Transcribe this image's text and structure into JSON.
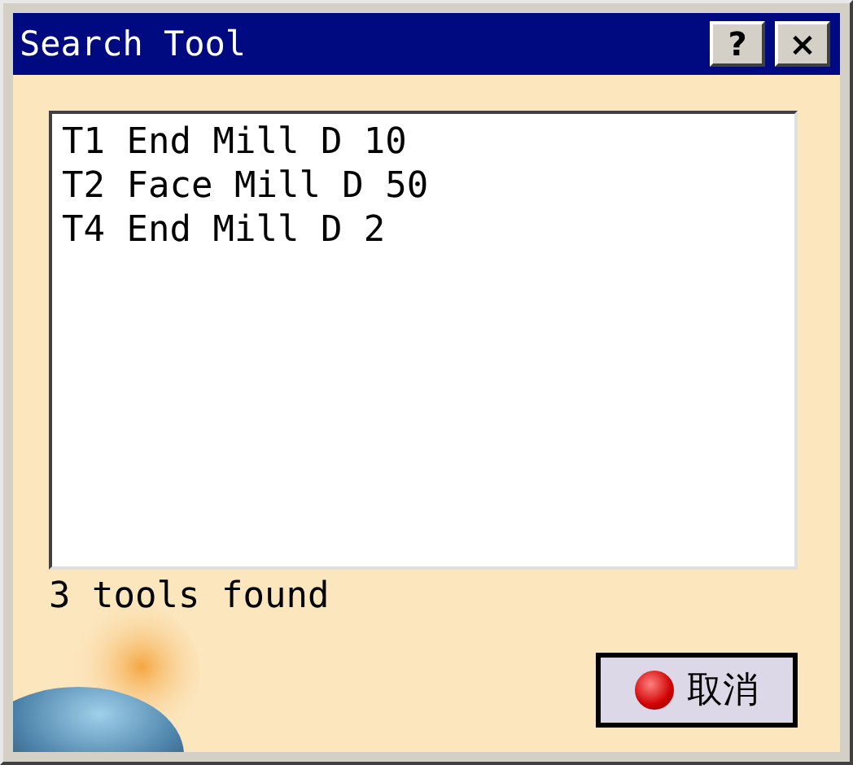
{
  "window": {
    "title": "Search Tool",
    "title_buttons": [
      "?",
      "×"
    ]
  },
  "results": [
    "T1 End Mill D 10",
    "T2 Face Mill D 50",
    "T4 End Mill D 2"
  ],
  "status": "3 tools found",
  "buttons": [
    "取消"
  ]
}
